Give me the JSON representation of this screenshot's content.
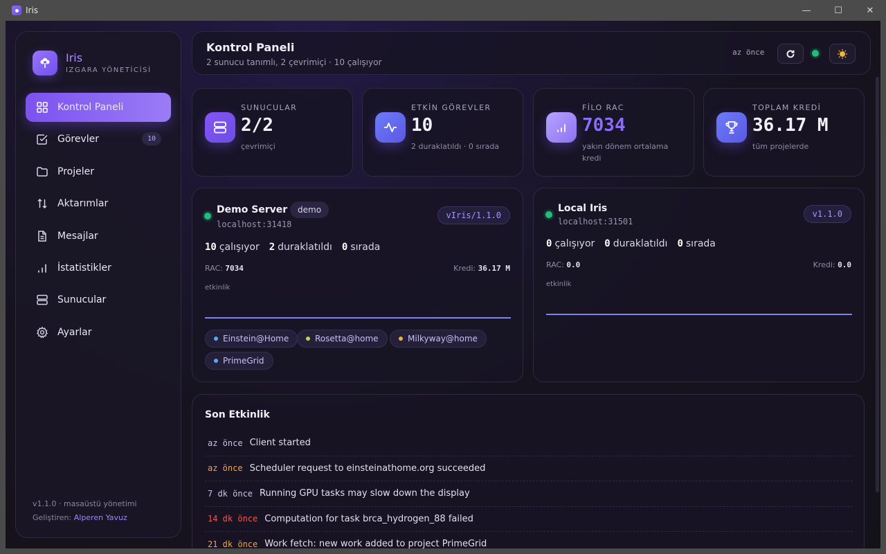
{
  "window": {
    "title": "Iris",
    "controls": [
      "—",
      "☐",
      "✕"
    ]
  },
  "brand": {
    "name": "Iris",
    "subtitle": "IZGARA YÖNETİCİSİ"
  },
  "nav": [
    {
      "label": "Kontrol Paneli",
      "icon": "grid-icon",
      "active": true
    },
    {
      "label": "Görevler",
      "icon": "checkbox-icon",
      "badge": "10"
    },
    {
      "label": "Projeler",
      "icon": "folder-icon"
    },
    {
      "label": "Aktarımlar",
      "icon": "transfer-icon"
    },
    {
      "label": "Mesajlar",
      "icon": "document-icon"
    },
    {
      "label": "İstatistikler",
      "icon": "bar-chart-icon"
    },
    {
      "label": "Sunucular",
      "icon": "server-icon"
    },
    {
      "label": "Ayarlar",
      "icon": "gear-icon"
    }
  ],
  "sidebar_footer": {
    "version": "v1.1.0 · masaüstü yönetimi",
    "dev_prefix": "Geliştiren:",
    "dev_name": "Alperen Yavuz"
  },
  "header": {
    "title": "Kontrol Paneli",
    "subtitle": "2 sunucu tanımlı, 2 çevrimiçi · 10 çalışıyor",
    "updated": "az önce"
  },
  "stats": [
    {
      "label": "SUNUCULAR",
      "value": "2/2",
      "note": "çevrimiçi",
      "icon": "server-icon"
    },
    {
      "label": "ETKİN GÖREVLER",
      "value": "10",
      "note": "2 duraklatıldı · 0 sırada",
      "icon": "pulse-icon"
    },
    {
      "label": "FİLO RAC",
      "value": "7034",
      "note": "yakın dönem ortalama kredi",
      "icon": "bar-chart-icon"
    },
    {
      "label": "TOPLAM KREDİ",
      "value": "36.17 M",
      "note": "tüm projelerde",
      "icon": "trophy-icon"
    }
  ],
  "servers": [
    {
      "name": "Demo Server",
      "tag": "demo",
      "host": "localhost:31418",
      "version": "vIris/1.1.0",
      "running": "10",
      "running_label": "çalışıyor",
      "paused": "2",
      "paused_label": "duraklatıldı",
      "queued": "0",
      "queued_label": "sırada",
      "rac_label": "RAC:",
      "rac": "7034",
      "credit_label": "Kredi:",
      "credit": "36.17 M",
      "activity_label": "etkinlik",
      "projects": [
        {
          "name": "Einstein@Home",
          "color": "#5aa8f0"
        },
        {
          "name": "Rosetta@home",
          "color": "#c8d04a"
        },
        {
          "name": "Milkyway@home",
          "color": "#e3b341"
        },
        {
          "name": "PrimeGrid",
          "color": "#5aa8f0"
        }
      ]
    },
    {
      "name": "Local Iris",
      "host": "localhost:31501",
      "version": "v1.1.0",
      "running": "0",
      "running_label": "çalışıyor",
      "paused": "0",
      "paused_label": "duraklatıldı",
      "queued": "0",
      "queued_label": "sırada",
      "rac_label": "RAC:",
      "rac": "0.0",
      "credit_label": "Kredi:",
      "credit": "0.0",
      "activity_label": "etkinlik"
    }
  ],
  "activity": {
    "title": "Son Etkinlik",
    "items": [
      {
        "time": "az önce",
        "message": "Client started",
        "color": "#c9c4e8"
      },
      {
        "time": "az önce",
        "message": "Scheduler request to einsteinathome.org succeeded",
        "color": "#f0a640"
      },
      {
        "time": "7 dk önce",
        "message": "Running GPU tasks may slow down the display",
        "color": "#c9c4e8"
      },
      {
        "time": "14 dk önce",
        "message": "Computation for task brca_hydrogen_88 failed",
        "color": "#f0584a"
      },
      {
        "time": "21 dk önce",
        "message": "Work fetch: new work added to project PrimeGrid",
        "color": "#f0a640"
      }
    ]
  },
  "colors": {
    "accent": "#7c52f0",
    "online": "#1fbf7a"
  }
}
